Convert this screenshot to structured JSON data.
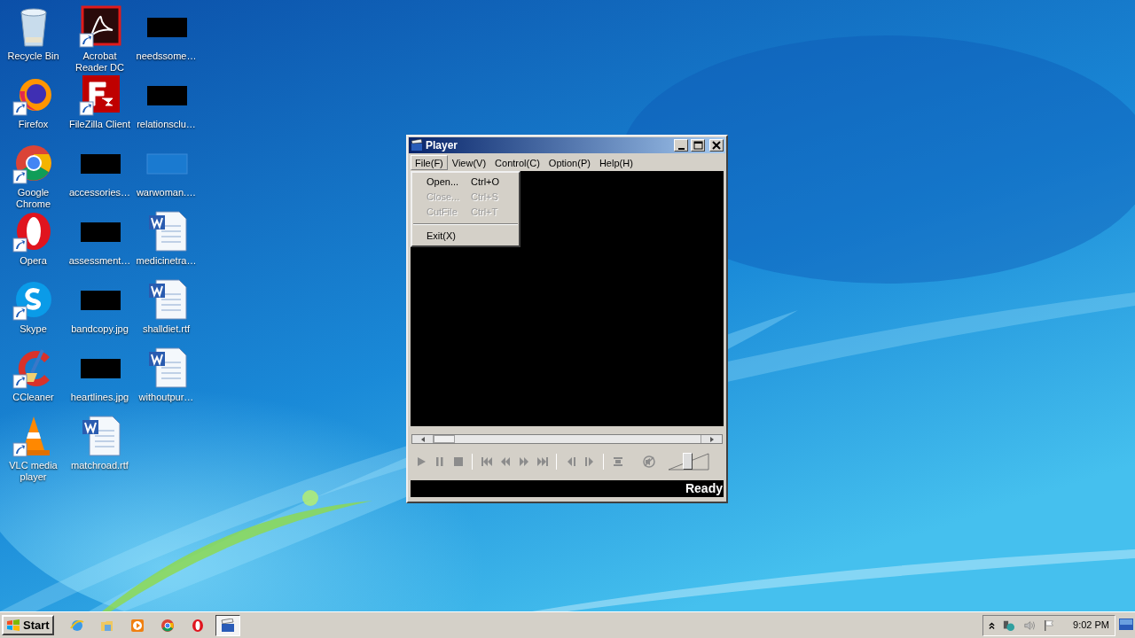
{
  "desktop": {
    "icons": [
      {
        "kind": "recycle",
        "label": "Recycle Bin",
        "shortcut": false
      },
      {
        "kind": "firefox",
        "label": "Firefox",
        "shortcut": true
      },
      {
        "kind": "chrome",
        "label": "Google Chrome",
        "shortcut": true
      },
      {
        "kind": "opera",
        "label": "Opera",
        "shortcut": true
      },
      {
        "kind": "skype",
        "label": "Skype",
        "shortcut": true
      },
      {
        "kind": "ccleaner",
        "label": "CCleaner",
        "shortcut": true
      },
      {
        "kind": "vlc",
        "label": "VLC media player",
        "shortcut": true
      },
      {
        "kind": "acrobat",
        "label": "Acrobat Reader DC",
        "shortcut": true
      },
      {
        "kind": "filezilla",
        "label": "FileZilla Client",
        "shortcut": true
      },
      {
        "kind": "black",
        "label": "accessories…",
        "shortcut": false
      },
      {
        "kind": "black",
        "label": "assessment…",
        "shortcut": false
      },
      {
        "kind": "black",
        "label": "bandcopy.jpg",
        "shortcut": false
      },
      {
        "kind": "black",
        "label": "heartlines.jpg",
        "shortcut": false
      },
      {
        "kind": "word",
        "label": "matchroad.rtf",
        "shortcut": false
      },
      {
        "kind": "black",
        "label": "needssome…",
        "shortcut": false
      },
      {
        "kind": "black",
        "label": "relationsclu…",
        "shortcut": false
      },
      {
        "kind": "blank",
        "label": "warwoman.…",
        "shortcut": false
      },
      {
        "kind": "word",
        "label": "medicinetra…",
        "shortcut": false
      },
      {
        "kind": "word",
        "label": "shalldiet.rtf",
        "shortcut": false
      },
      {
        "kind": "word",
        "label": "withoutpur…",
        "shortcut": false
      }
    ]
  },
  "player": {
    "title": "Player",
    "menu": [
      {
        "label": "File(F)",
        "selected": true
      },
      {
        "label": "View(V)",
        "selected": false
      },
      {
        "label": "Control(C)",
        "selected": false
      },
      {
        "label": "Option(P)",
        "selected": false
      },
      {
        "label": "Help(H)",
        "selected": false
      }
    ],
    "file_menu": [
      {
        "kind": "item",
        "label": "Open...",
        "shortcut": "Ctrl+O",
        "disabled": false
      },
      {
        "kind": "item",
        "label": "Close...",
        "shortcut": "Ctrl+S",
        "disabled": true
      },
      {
        "kind": "item",
        "label": "CutFile",
        "shortcut": "Ctrl+T",
        "disabled": true
      },
      {
        "kind": "separator"
      },
      {
        "kind": "item",
        "label": "Exit(X)",
        "disabled": false
      }
    ],
    "seek": {
      "level": 0.04
    },
    "controls": [
      {
        "kind": "play"
      },
      {
        "kind": "pause"
      },
      {
        "kind": "stop"
      },
      {
        "kind": "separator"
      },
      {
        "kind": "prev"
      },
      {
        "kind": "rewind"
      },
      {
        "kind": "forward"
      },
      {
        "kind": "next"
      },
      {
        "kind": "separator"
      },
      {
        "kind": "step-back"
      },
      {
        "kind": "step-forward"
      },
      {
        "kind": "separator"
      },
      {
        "kind": "fullscreen"
      },
      {
        "kind": "mute"
      }
    ],
    "volume": {
      "level": 0.45
    },
    "status": "Ready"
  },
  "taskbar": {
    "start": "Start",
    "apps": [
      {
        "kind": "ie",
        "selected": false
      },
      {
        "kind": "explorer",
        "selected": false
      },
      {
        "kind": "media",
        "selected": false
      },
      {
        "kind": "chrome",
        "selected": false
      },
      {
        "kind": "opera",
        "selected": false
      },
      {
        "kind": "player",
        "selected": true
      }
    ],
    "time": "9:02 PM"
  }
}
